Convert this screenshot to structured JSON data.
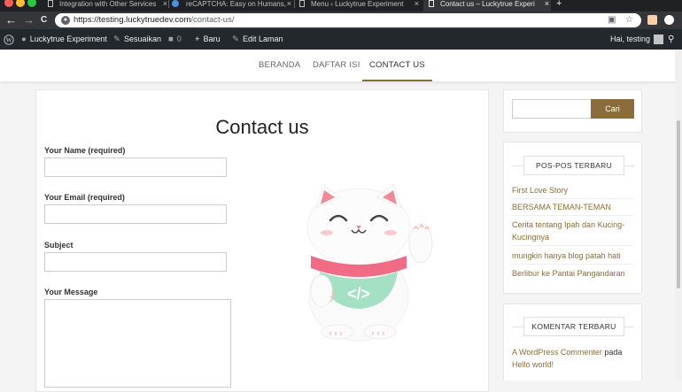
{
  "browser": {
    "tabs": [
      {
        "title": "Integration with Other Services"
      },
      {
        "title": "reCAPTCHA: Easy on Humans,"
      },
      {
        "title": "Menu ‹ Luckytrue Experiment"
      },
      {
        "title": "Contact us – Luckytrue Experi"
      }
    ],
    "close_glyph": "×",
    "new_tab_glyph": "+",
    "url_host": "https://testing.luckytruedev.com",
    "url_path": "/contact-us/",
    "nav": {
      "back": "←",
      "forward": "→",
      "reload": "C"
    }
  },
  "adminbar": {
    "site_name": "Luckytrue Experiment",
    "customize": "Sesuaikan",
    "comments_count": "0",
    "new_label": "Baru",
    "edit_page": "Edit Laman",
    "greeting": "Hai, testing"
  },
  "menu": {
    "items": [
      {
        "label": "BERANDA"
      },
      {
        "label": "DAFTAR ISI"
      },
      {
        "label": "CONTACT US"
      }
    ]
  },
  "page": {
    "title": "Contact us",
    "form": {
      "name_label": "Your Name (required)",
      "email_label": "Your Email (required)",
      "subject_label": "Subject",
      "message_label": "Your Message"
    },
    "illustration_icon": "maneki-neko-cat-icon",
    "code_glyph": "</>"
  },
  "sidebar": {
    "search_button": "Cari",
    "recent_posts_title": "POS-POS TERBARU",
    "recent_posts": [
      "First Love Story",
      "BERSAMA TEMAN-TEMAN",
      "Cerita tentang Ipah dan Kucing-Kucingnya",
      "mungkin hanya blog patah hati",
      "Berlibur ke Pantai Pangandaran"
    ],
    "recent_comments_title": "KOMENTAR TERBARU",
    "comment_author": "A WordPress Commenter",
    "comment_on": "pada",
    "comment_post": "Hello world!"
  },
  "colors": {
    "accent": "#8a6d3b",
    "adminbar": "#23282d",
    "tabbar": "#202124"
  }
}
